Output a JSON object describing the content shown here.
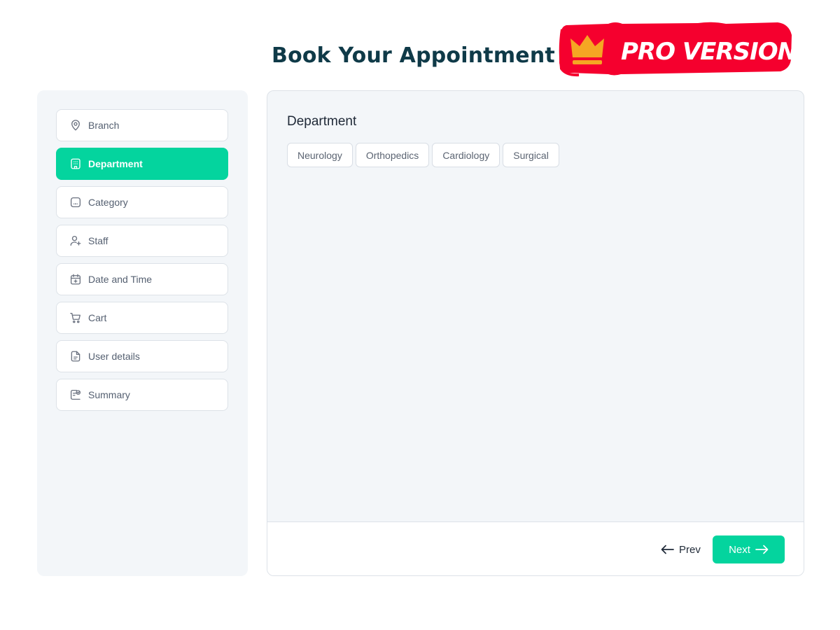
{
  "header": {
    "title": "Book Your Appointment"
  },
  "badge": {
    "text": "PRO VERSION",
    "icon": "crown-icon",
    "bg_color": "#f5002e",
    "icon_color": "#f5a623",
    "text_color": "#ffffff"
  },
  "sidebar": {
    "active_color": "#04d49e",
    "steps": [
      {
        "label": "Branch",
        "icon": "location-pin-icon",
        "active": false
      },
      {
        "label": "Department",
        "icon": "building-icon",
        "active": true
      },
      {
        "label": "Category",
        "icon": "category-icon",
        "active": false
      },
      {
        "label": "Staff",
        "icon": "user-plus-icon",
        "active": false
      },
      {
        "label": "Date and Time",
        "icon": "calendar-plus-icon",
        "active": false
      },
      {
        "label": "Cart",
        "icon": "cart-icon",
        "active": false
      },
      {
        "label": "User details",
        "icon": "document-icon",
        "active": false
      },
      {
        "label": "Summary",
        "icon": "summary-check-icon",
        "active": false
      }
    ]
  },
  "main": {
    "heading": "Department",
    "departments": [
      "Neurology",
      "Orthopedics",
      "Cardiology",
      "Surgical"
    ]
  },
  "footer": {
    "prev_label": "Prev",
    "next_label": "Next"
  }
}
